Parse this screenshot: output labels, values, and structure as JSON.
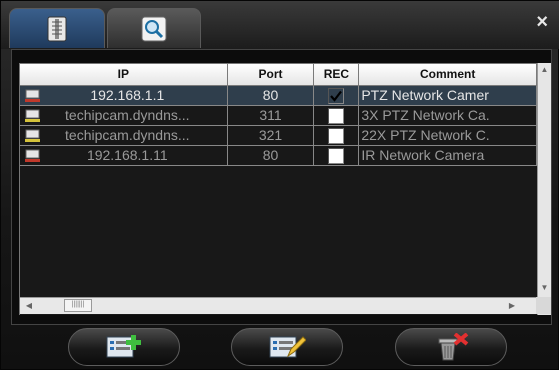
{
  "window": {
    "close_glyph": "×"
  },
  "tabs": [
    {
      "icon": "address-book-icon",
      "active": true
    },
    {
      "icon": "search-icon",
      "active": false
    }
  ],
  "table": {
    "headers": {
      "ip": "IP",
      "port": "Port",
      "rec": "REC",
      "comment": "Comment"
    },
    "rows": [
      {
        "ip": "192.168.1.1",
        "port": "80",
        "rec": true,
        "comment": "PTZ Network Camer",
        "selected": true,
        "icon_color": "#c0392b"
      },
      {
        "ip": "techipcam.dyndns...",
        "port": "311",
        "rec": false,
        "comment": "3X PTZ Network Ca.",
        "selected": false,
        "icon_color": "#d4c23a"
      },
      {
        "ip": "techipcam.dyndns...",
        "port": "321",
        "rec": false,
        "comment": "22X PTZ Network C.",
        "selected": false,
        "icon_color": "#d4c23a"
      },
      {
        "ip": "192.168.1.11",
        "port": "80",
        "rec": false,
        "comment": "IR Network Camera",
        "selected": false,
        "icon_color": "#c0392b"
      }
    ]
  },
  "buttons": [
    {
      "name": "add-device-button",
      "icon": "add-list-icon"
    },
    {
      "name": "edit-device-button",
      "icon": "edit-list-icon"
    },
    {
      "name": "delete-device-button",
      "icon": "trash-delete-icon"
    }
  ],
  "colors": {
    "selected_row": "#2f3e4c",
    "active_tab": "#2a4a72"
  }
}
